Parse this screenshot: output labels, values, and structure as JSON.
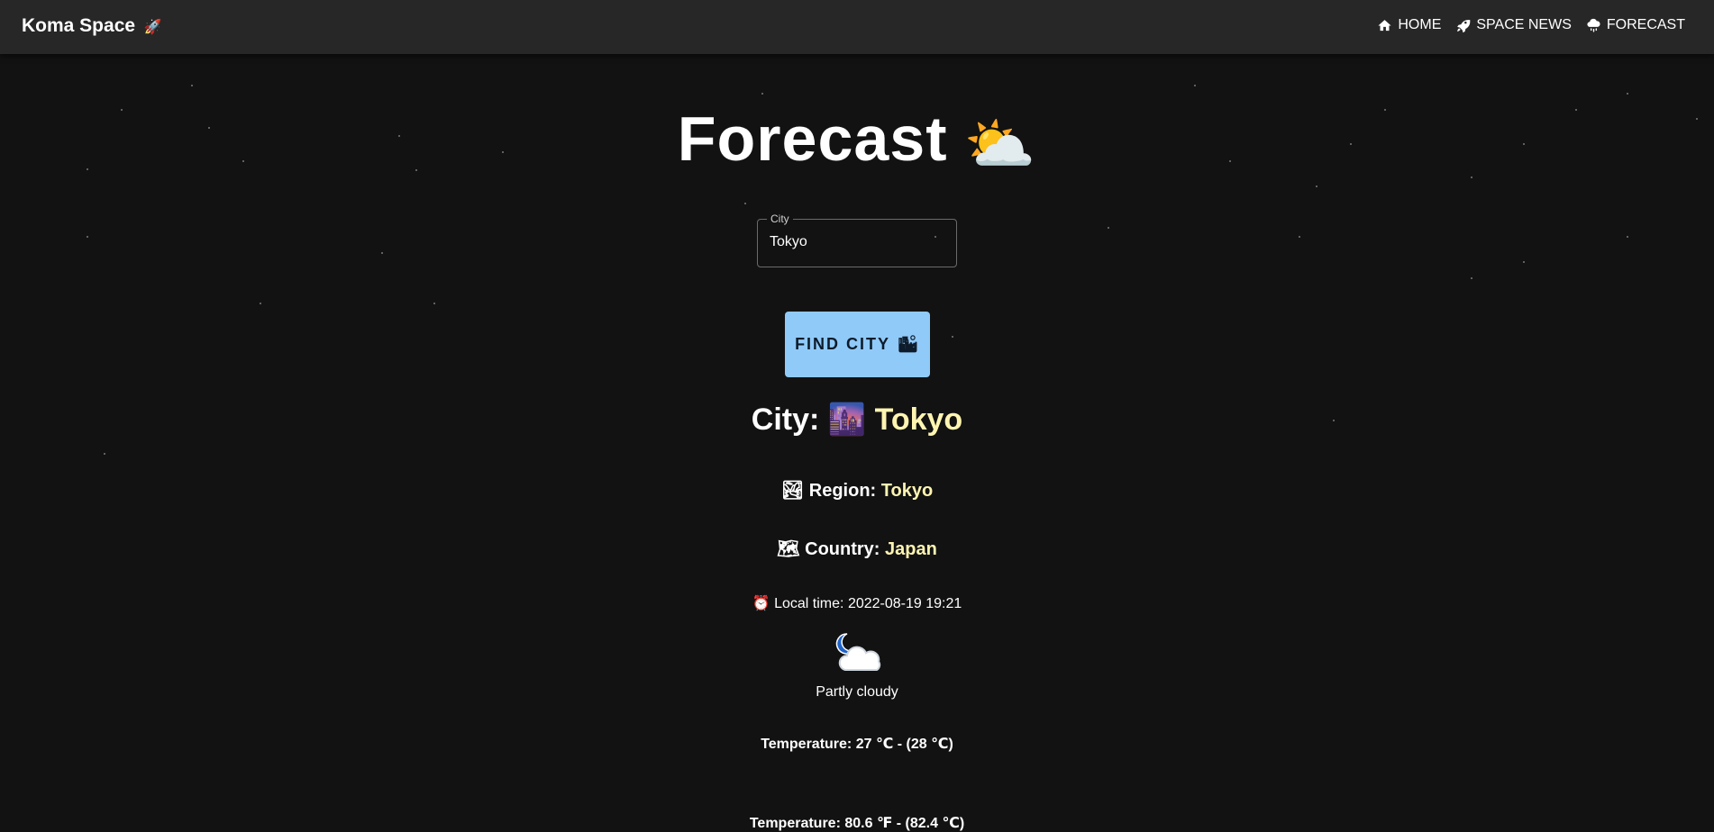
{
  "app": {
    "brand": "Koma Space",
    "brand_icon": "rocket-icon"
  },
  "nav": {
    "items": [
      {
        "label": "HOME",
        "icon": "home-icon"
      },
      {
        "label": "SPACE NEWS",
        "icon": "rocket-icon"
      },
      {
        "label": "FORECAST",
        "icon": "rain-cloud-icon"
      }
    ]
  },
  "page": {
    "title": "Forecast",
    "title_emoji": "⛅"
  },
  "search": {
    "label": "City",
    "value": "Tokyo"
  },
  "find_button": {
    "label": "FIND CITY",
    "emoji": "🏙"
  },
  "result": {
    "city_label": "City:",
    "city_emoji": "🌆",
    "city": "Tokyo",
    "region_emoji": "🏞",
    "region_label": "Region:",
    "region": "Tokyo",
    "country_emoji": "🗺",
    "country_label": "Country:",
    "country": "Japan",
    "localtime_emoji": "⏰",
    "localtime_label": "Local time:",
    "localtime": "2022-08-19 19:21",
    "weather_icon": "night-partly-cloudy-icon",
    "condition": "Partly cloudy",
    "temp_c_text": "Temperature: 27 ℃ - (28 ℃)",
    "temp_f_text": "Temperature: 80.6 ℉ - (82.4 ℃)"
  },
  "colors": {
    "background": "#121212",
    "appbar": "#272727",
    "button": "#90caf9",
    "highlight": "#fff5b1"
  }
}
